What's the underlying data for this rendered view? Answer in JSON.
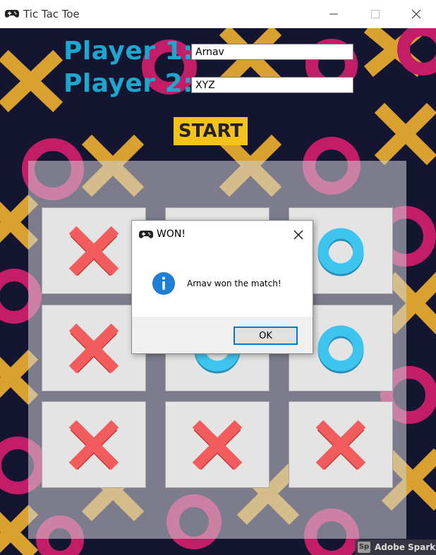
{
  "window": {
    "title": "Tic Tac Toe",
    "icon": "gamepad-icon"
  },
  "form": {
    "player1_label": "Player 1:",
    "player1_value": "Arnav",
    "player2_label": "Player 2:",
    "player2_value": "XYZ",
    "start_label": "START"
  },
  "board": {
    "cells": [
      "X",
      "",
      "O",
      "X",
      "O",
      "O",
      "X",
      "X",
      "X"
    ],
    "x_color": "#f25c5c",
    "o_color": "#3ec5ef"
  },
  "dialog": {
    "title": "WON!",
    "message": "Arnav won the match!",
    "ok_label": "OK",
    "icon": "info-icon"
  },
  "watermark": {
    "badge": "Sp",
    "text": "Adobe Spark"
  }
}
